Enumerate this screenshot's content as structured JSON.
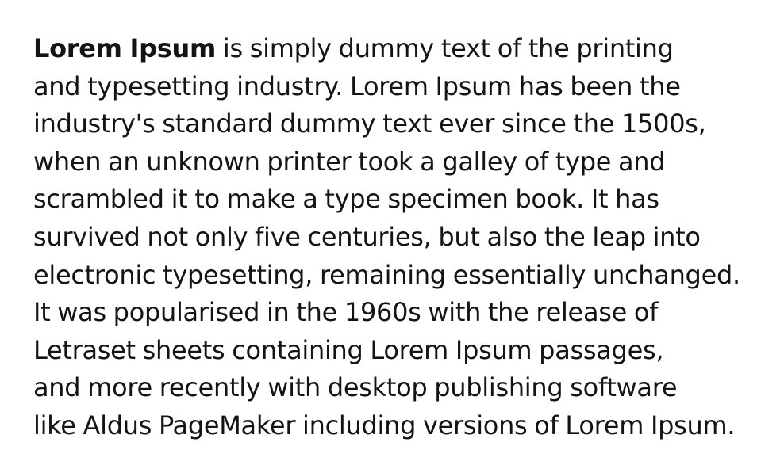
{
  "paragraph": {
    "lead_bold": "Lorem Ipsum",
    "first_line_rest": " is simply dummy text of the printing",
    "lines": [
      "and typesetting industry. Lorem Ipsum has been the",
      "industry's standard dummy text ever since the 1500s,",
      "when an unknown printer took a galley of type and",
      "scrambled it to make a type specimen book. It has",
      "survived not only five centuries, but also the leap into",
      "electronic typesetting, remaining essentially unchanged.",
      "It was popularised in the 1960s with the release of",
      "Letraset sheets containing Lorem Ipsum passages,",
      "and more recently with desktop publishing software",
      "like Aldus PageMaker including versions of Lorem Ipsum."
    ]
  }
}
